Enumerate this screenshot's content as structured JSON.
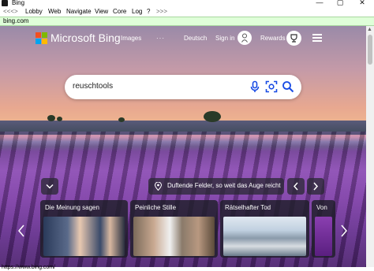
{
  "window": {
    "title": "Bing",
    "controls": [
      "—",
      "▢",
      "✕"
    ]
  },
  "menu": [
    "<<<>",
    "Lobby",
    "Web",
    "Navigate",
    "View",
    "Core",
    "Log",
    "?",
    ">>>"
  ],
  "address": "bing.com",
  "header": {
    "brand": "Microsoft Bing",
    "images": "Images",
    "more": "···",
    "language": "Deutsch",
    "signin": "Sign in",
    "rewards": "Rewards"
  },
  "search": {
    "value": "reuschtools"
  },
  "location": {
    "caption": "Duftende Felder, so weit das Auge reicht"
  },
  "cards": [
    {
      "title": "Die Meinung sagen"
    },
    {
      "title": "Peinliche Stille"
    },
    {
      "title": "Rätselhafter Tod"
    },
    {
      "title": "Von"
    }
  ],
  "status": "https://www.bing.com/",
  "colors": {
    "address_bg": "#dfffd9",
    "card_bg": "#1e1e28",
    "logo_red": "#f25022",
    "logo_green": "#7fba00",
    "logo_blue": "#00a4ef",
    "logo_yellow": "#ffb900",
    "accent_blue": "#174ae4"
  }
}
